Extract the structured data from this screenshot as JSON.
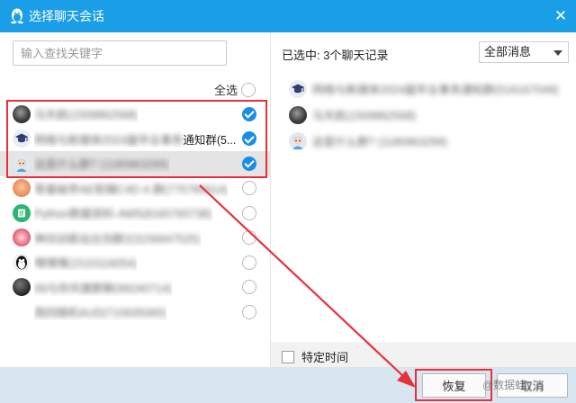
{
  "window": {
    "title": "选择聊天会话",
    "app_icon": "qq-penguin-icon",
    "close_glyph": "✕"
  },
  "search": {
    "placeholder": "输入查找关键字"
  },
  "select_all_label": "全选",
  "conversations": [
    {
      "name": "马天航(1509862568)",
      "selected": true,
      "highlight": false,
      "avatar": "photo-avatar"
    },
    {
      "name_prefix": "网络与新媒体2024届毕业事务",
      "name_suffix": "通知群(5...",
      "selected": true,
      "highlight": false,
      "avatar": "graduation-cap-avatar"
    },
    {
      "name": "这是什么群? (1180963299)",
      "selected": true,
      "highlight": true,
      "avatar": "cartoon-avatar"
    },
    {
      "name": "零基础学AE剪辑C4D·4·群(775795614)",
      "selected": false,
      "highlight": false,
      "avatar": "orange-avatar"
    },
    {
      "name": "Python数据资料·AW5(8165765738)",
      "selected": false,
      "highlight": false,
      "avatar": "green-doc-avatar"
    },
    {
      "name": "神剑训练站台剑群2(3156947525)",
      "selected": false,
      "highlight": false,
      "avatar": "pink-avatar"
    },
    {
      "name": "嘿嘿嘿(1510116054)",
      "selected": false,
      "highlight": false,
      "avatar": "penguin-avatar"
    },
    {
      "name": "06与你共建群聊(99240714)",
      "selected": false,
      "highlight": false,
      "avatar": "dark-avatar"
    },
    {
      "name": "周四随机AUD(715935065)",
      "selected": false,
      "highlight": false,
      "avatar": "none"
    }
  ],
  "right": {
    "selected_count_text": "已选中: 3个聊天记录",
    "filter_value": "全部消息",
    "selected_items": [
      {
        "name": "网络与新媒体2024届毕业事务通知群(516167049)",
        "avatar": "graduation-cap-avatar"
      },
      {
        "name": "马天航(1509862568)",
        "avatar": "photo-avatar"
      },
      {
        "name": "这是什么群? (1180963299)",
        "avatar": "cartoon-avatar"
      }
    ],
    "specific_time_label": "特定时间"
  },
  "buttons": {
    "restore": "恢复",
    "cancel": "取消"
  },
  "watermark": "@数据蛙",
  "colors": {
    "titlebar": "#1a9ee8",
    "accent_check": "#1a8de6",
    "annotation_red": "#e8303a",
    "footer": "#d7e6f1"
  }
}
